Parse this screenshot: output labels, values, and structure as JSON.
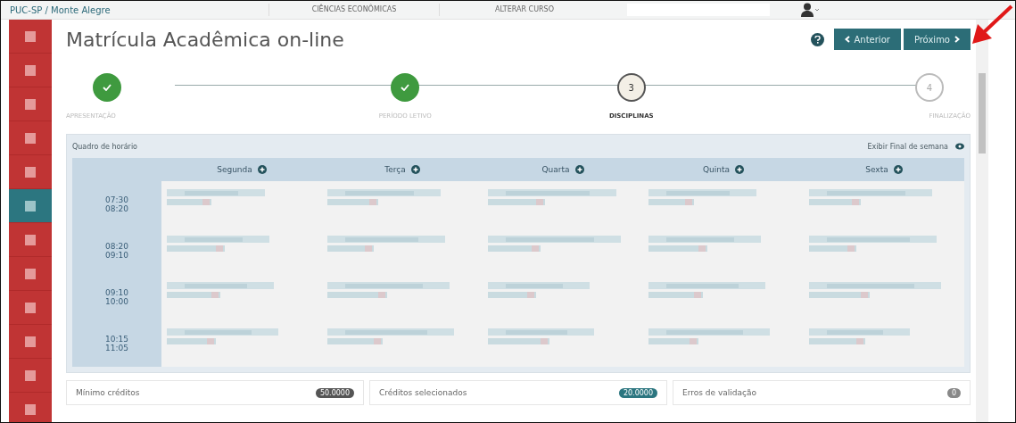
{
  "top_bar": {
    "breadcrumb": "PUC-SP / Monte Alegre",
    "links": [
      "CIÊNCIAS ECONÔMICAS",
      "ALTERAR CURSO"
    ]
  },
  "sidebar": {
    "items": [
      {
        "selected": false
      },
      {
        "selected": false
      },
      {
        "selected": false
      },
      {
        "selected": false
      },
      {
        "selected": false
      },
      {
        "selected": true
      },
      {
        "selected": false
      },
      {
        "selected": false
      },
      {
        "selected": false
      },
      {
        "selected": false
      },
      {
        "selected": false
      },
      {
        "selected": false
      }
    ]
  },
  "page": {
    "title": "Matrícula Acadêmica on-line",
    "buttons": [
      {
        "label": "Anterior",
        "kind": "prev"
      },
      {
        "label": "Próximo",
        "kind": "next"
      }
    ]
  },
  "steps": [
    {
      "label": "APRESENTAÇÃO",
      "completed": true,
      "current": false
    },
    {
      "label": "PERÍODO LETIVO",
      "completed": true,
      "current": false
    },
    {
      "label": "DISCIPLINAS",
      "completed": false,
      "current": true,
      "number": "3"
    },
    {
      "label": "FINALIZAÇÃO",
      "completed": false,
      "current": false,
      "number": "4"
    }
  ],
  "schedule": {
    "title": "Quadro de horário",
    "weekend_toggle": "Exibir Final de semana",
    "days": [
      "Segunda",
      "Terça",
      "Quarta",
      "Quinta",
      "Sexta"
    ],
    "rows": [
      {
        "start": "07:30",
        "end": "08:20"
      },
      {
        "start": "08:20",
        "end": "09:10"
      },
      {
        "start": "09:10",
        "end": "10:00"
      },
      {
        "start": "10:15",
        "end": "11:05"
      }
    ]
  },
  "summary": [
    {
      "label": "Mínimo créditos",
      "value": "50.0000",
      "kind": "dark"
    },
    {
      "label": "Créditos selecionados",
      "value": "20.0000",
      "kind": "teal"
    },
    {
      "label": "Erros de validação",
      "value": "0",
      "kind": "grey"
    }
  ]
}
